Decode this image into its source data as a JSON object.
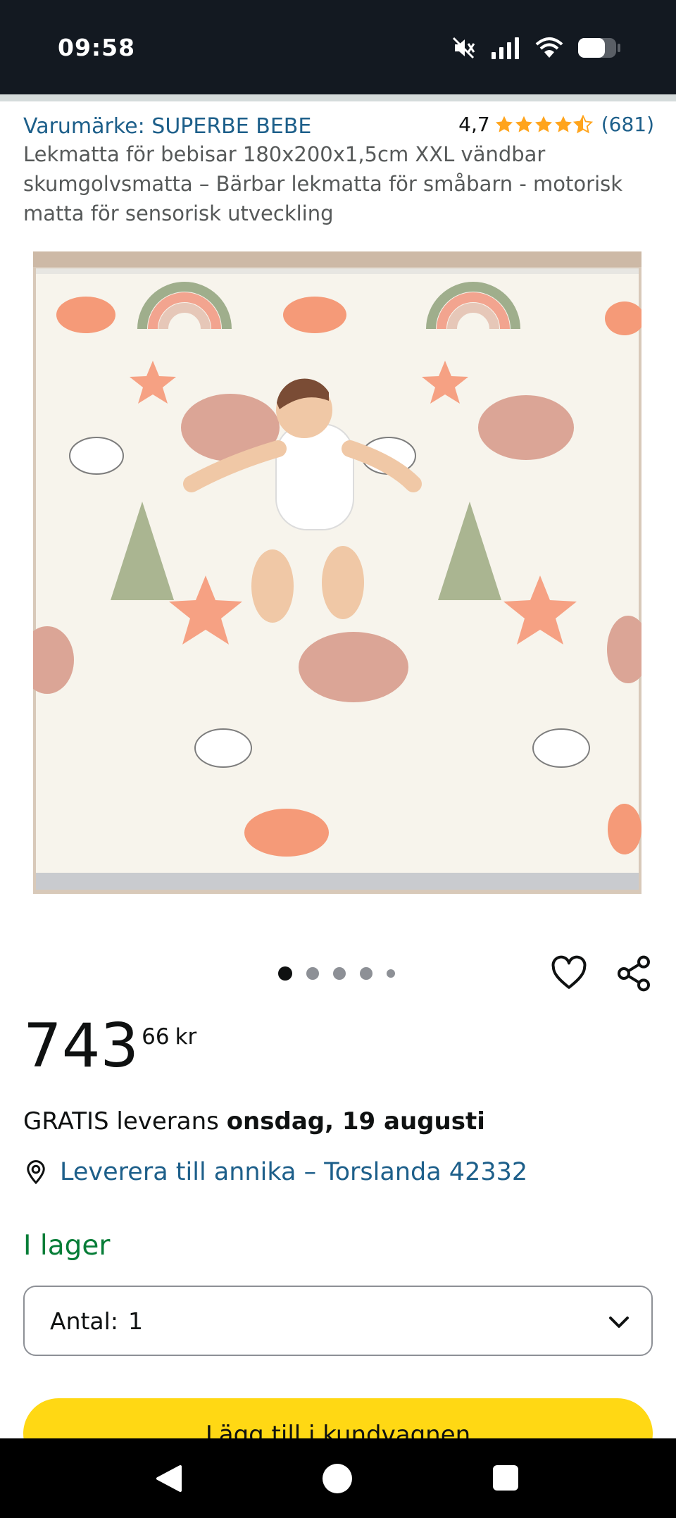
{
  "status_bar": {
    "time": "09:58",
    "icons": [
      "mute-icon",
      "signal-icon",
      "wifi-icon",
      "battery-icon"
    ]
  },
  "product": {
    "brand_link": "Varumärke: SUPERBE BEBE",
    "rating_value": "4,7",
    "rating_stars": 4.5,
    "rating_count": "(681)",
    "title": "Lekmatta för bebisar 180x200x1,5cm XXL vändbar skumgolvsmatta – Bärbar lekmatta för småbarn - motorisk matta för sensorisk utveckling",
    "image_count": 5,
    "image_active_index": 0
  },
  "price": {
    "whole": "743",
    "fraction": "66",
    "currency": "kr"
  },
  "delivery": {
    "prefix": "GRATIS leverans",
    "date": "onsdag, 19 augusti"
  },
  "location": {
    "text": "Leverera till annika – Torslanda 42332",
    "icon": "location-pin-icon"
  },
  "stock": {
    "text": "I lager"
  },
  "quantity": {
    "label": "Antal:",
    "value": "1"
  },
  "cart_button": {
    "label": "Lägg till i kundvagnen"
  },
  "colors": {
    "header": "#131921",
    "link": "#1d5f8a",
    "star": "#ffa41c",
    "in_stock": "#067d37",
    "cart_button": "#ffd814"
  }
}
